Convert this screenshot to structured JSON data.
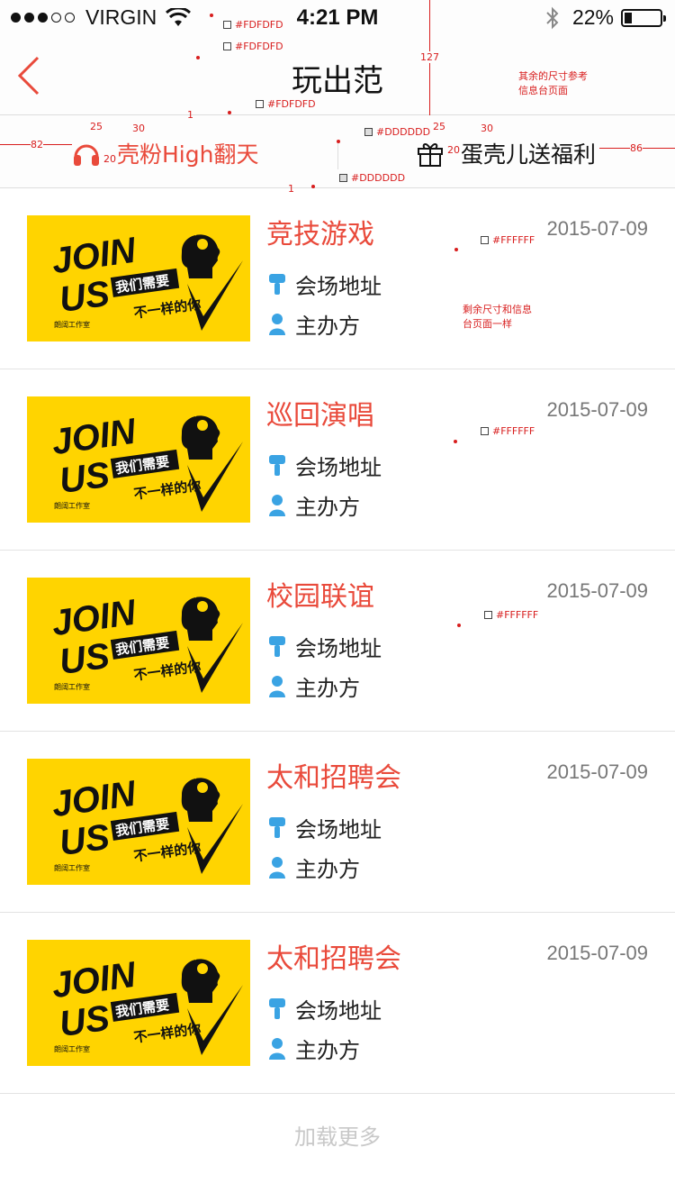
{
  "status_bar": {
    "carrier": "VIRGIN",
    "time": "4:21 PM",
    "battery": "22%",
    "battery_level": 0.22
  },
  "nav": {
    "title": "玩出范",
    "back_icon": "chevron-left-icon"
  },
  "tabs": [
    {
      "label": "壳粉High翻天",
      "icon": "headphones-icon",
      "color": "#e94a3b"
    },
    {
      "label": "蛋壳儿送福利",
      "icon": "gift-icon",
      "color": "#111111"
    }
  ],
  "events": [
    {
      "title": "竞技游戏",
      "date": "2015-07-09",
      "venue": "会场地址",
      "host": "主办方"
    },
    {
      "title": "巡回演唱",
      "date": "2015-07-09",
      "venue": "会场地址",
      "host": "主办方"
    },
    {
      "title": "校园联谊",
      "date": "2015-07-09",
      "venue": "会场地址",
      "host": "主办方"
    },
    {
      "title": "太和招聘会",
      "date": "2015-07-09",
      "venue": "会场地址",
      "host": "主办方"
    },
    {
      "title": "太和招聘会",
      "date": "2015-07-09",
      "venue": "会场地址",
      "host": "主办方"
    }
  ],
  "thumbnail": {
    "line1": "JOIN",
    "line2": "US",
    "tag1": "我们需要",
    "tag2": "不一样的你",
    "studio": "朗阔工作室"
  },
  "load_more": "加载更多",
  "annotations": {
    "height_127": "127",
    "w_82": "82",
    "w_86": "86",
    "v25a": "25",
    "v30a": "30",
    "v25b": "25",
    "v30b": "30",
    "g20a": "20",
    "g20b": "20",
    "one_a": "1",
    "one_b": "1",
    "c_fd1": "#FDFDFD",
    "c_fd2": "#FDFDFD",
    "c_fd3": "#FDFDFD",
    "c_dd1": "#DDDDDD",
    "c_dd2": "#DDDDDD",
    "c_ff1": "#FFFFFF",
    "c_ff2": "#FFFFFF",
    "c_ff3": "#FFFFFF",
    "note1_l1": "其余的尺寸参考",
    "note1_l2": "信息台页面",
    "note2_l1": "剩余尺寸和信息",
    "note2_l2": "台页面一样"
  },
  "colors": {
    "accent": "#e94a3b",
    "icon_blue": "#3aa3e3",
    "divider": "#dddddd",
    "bar_bg": "#fdfdfd",
    "thumb_bg": "#ffd400"
  }
}
